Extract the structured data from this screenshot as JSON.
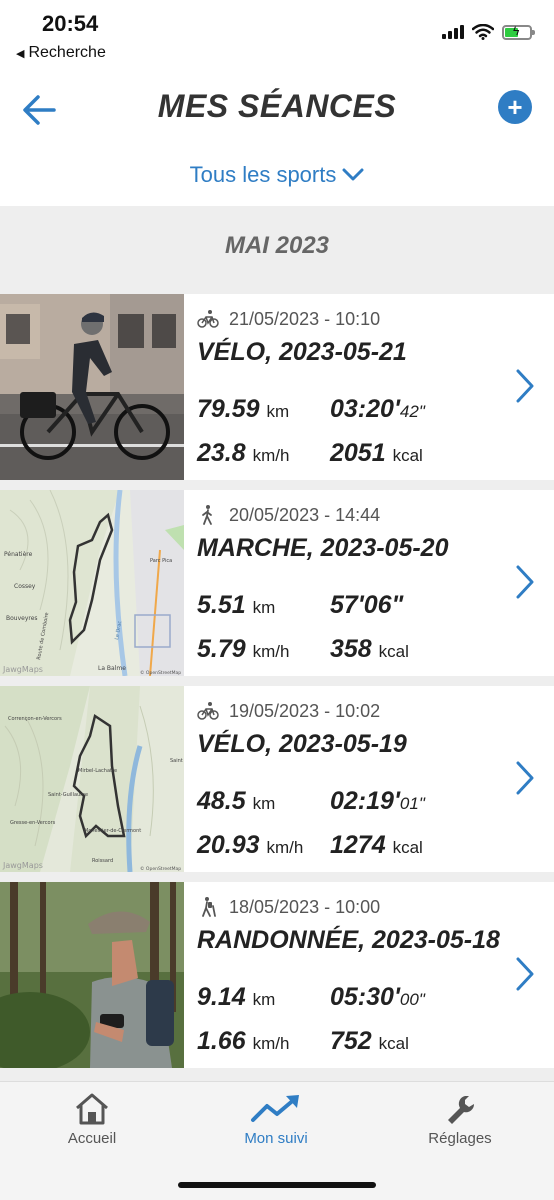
{
  "status": {
    "time": "20:54",
    "back_label": "Recherche"
  },
  "header": {
    "title": "MES SÉANCES",
    "filter_label": "Tous les sports"
  },
  "month": "MAI 2023",
  "sessions": [
    {
      "sport": "bike-icon",
      "date": "21/05/2023 - 10:10",
      "title": "VÉLO, 2023-05-21",
      "distance": "79.59",
      "distance_unit": "km",
      "duration_main": "03:20",
      "duration_sec": "42",
      "speed": "23.8",
      "speed_unit": "km/h",
      "kcal": "2051",
      "kcal_unit": "kcal"
    },
    {
      "sport": "walk-icon",
      "date": "20/05/2023 - 14:44",
      "title": "MARCHE, 2023-05-20",
      "distance": "5.51",
      "distance_unit": "km",
      "duration_main": "57'06\"",
      "duration_sec": "",
      "speed": "5.79",
      "speed_unit": "km/h",
      "kcal": "358",
      "kcal_unit": "kcal"
    },
    {
      "sport": "bike-icon",
      "date": "19/05/2023 - 10:02",
      "title": "VÉLO, 2023-05-19",
      "distance": "48.5",
      "distance_unit": "km",
      "duration_main": "02:19",
      "duration_sec": "01",
      "speed": "20.93",
      "speed_unit": "km/h",
      "kcal": "1274",
      "kcal_unit": "kcal"
    },
    {
      "sport": "hike-icon",
      "date": "18/05/2023 - 10:00",
      "title": "RANDONNÉE, 2023-05-18",
      "distance": "9.14",
      "distance_unit": "km",
      "duration_main": "05:30",
      "duration_sec": "00",
      "speed": "1.66",
      "speed_unit": "km/h",
      "kcal": "752",
      "kcal_unit": "kcal"
    }
  ],
  "map_labels": {
    "m1": [
      "Pénatière",
      "Cossey",
      "Bouveyres",
      "La Balme",
      "Parc Pica",
      "Route de Comboire",
      "Le Drac",
      "© OpenStreetMap",
      "JawgMaps"
    ],
    "m2": [
      "Corrençon-en-Vercors",
      "Mirbel-Lachatre",
      "Saint-Guillaume",
      "Monestier-de-Clermont",
      "Gresse-en-Vercors",
      "Roissard",
      "Saint",
      "© OpenStreetMap",
      "JawgMaps"
    ]
  },
  "tabs": [
    {
      "label": "Accueil",
      "icon": "home-icon"
    },
    {
      "label": "Mon suivi",
      "icon": "trend-icon"
    },
    {
      "label": "Réglages",
      "icon": "wrench-icon"
    }
  ],
  "colors": {
    "accent": "#2f7dc4",
    "text": "#222222",
    "background": "#eeeeee"
  }
}
